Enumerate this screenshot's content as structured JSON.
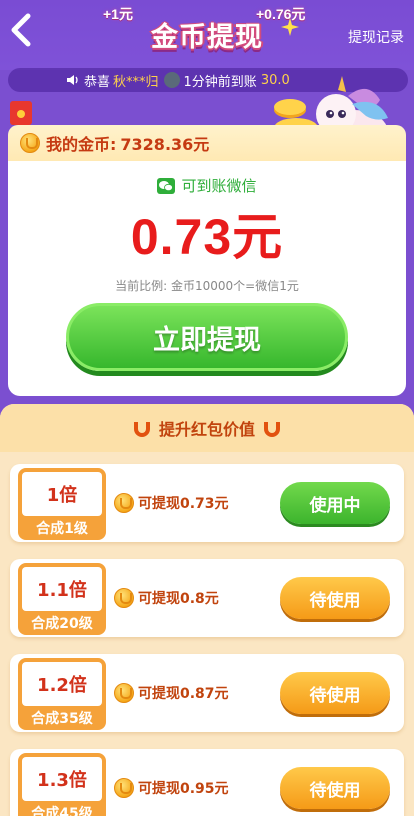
{
  "header": {
    "title": "金币提现",
    "records_label": "提现记录",
    "bonus_left": "+1元",
    "bonus_right": "+0.76元"
  },
  "marquee": {
    "prefix": "恭喜",
    "user": "秋***归",
    "message": "1分钟前到账",
    "amount": "30.0"
  },
  "gold": {
    "label": "我的金币:",
    "value": "7328.36元"
  },
  "card": {
    "wechat_label": "可到账微信",
    "amount": "0.73元",
    "ratio": "当前比例: 金币10000个=微信1元",
    "withdraw_label": "立即提现"
  },
  "section": {
    "title": "提升红包价值"
  },
  "tiers": [
    {
      "multiplier": "1倍",
      "level": "合成1级",
      "info": "可提现0.73元",
      "button": "使用中"
    },
    {
      "multiplier": "1.1倍",
      "level": "合成20级",
      "info": "可提现0.8元",
      "button": "待使用"
    },
    {
      "multiplier": "1.2倍",
      "level": "合成35级",
      "info": "可提现0.87元",
      "button": "待使用"
    },
    {
      "multiplier": "1.3倍",
      "level": "合成45级",
      "info": "可提现0.95元",
      "button": "待使用"
    }
  ],
  "colors": {
    "accent_red": "#e81c1c",
    "green_button": "#3cb42d",
    "orange_button": "#f59a17",
    "background_purple": "#7b4fd0"
  }
}
